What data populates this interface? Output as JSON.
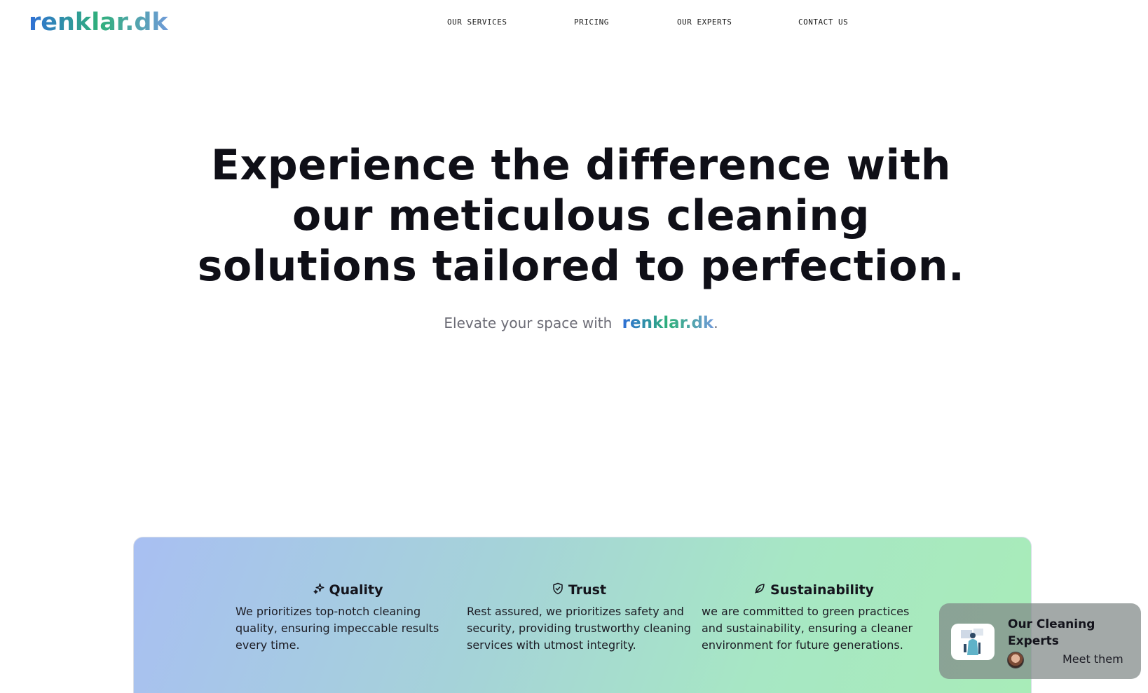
{
  "header": {
    "logo": "renklar.dk",
    "nav": [
      {
        "label": "OUR SERVICES"
      },
      {
        "label": "PRICING"
      },
      {
        "label": "OUR EXPERTS"
      },
      {
        "label": "CONTACT US"
      }
    ]
  },
  "hero": {
    "title_lines": [
      "Experience the difference with",
      "our meticulous cleaning",
      "solutions tailored to perfection."
    ],
    "subtitle_prefix": "Elevate your space with",
    "subtitle_brand": "renklar.dk",
    "subtitle_suffix": "."
  },
  "features": [
    {
      "title": "Quality",
      "icon": "sparkles-icon",
      "description": "We prioritizes top-notch cleaning quality, ensuring impeccable results every time."
    },
    {
      "title": "Trust",
      "icon": "shield-check-icon",
      "description": "Rest assured, we prioritizes safety and security, providing trustworthy cleaning services with utmost integrity."
    },
    {
      "title": "Sustainability",
      "icon": "leaf-icon",
      "description": "we are committed to green practices and sustainability, ensuring a cleaner environment for future generations."
    }
  ],
  "experts_card": {
    "title": "Our Cleaning Experts",
    "link": "Meet them"
  },
  "colors": {
    "brand_blue": "#2f6fd6",
    "brand_green": "#2fb07a",
    "text_dark": "#0f0f17"
  }
}
